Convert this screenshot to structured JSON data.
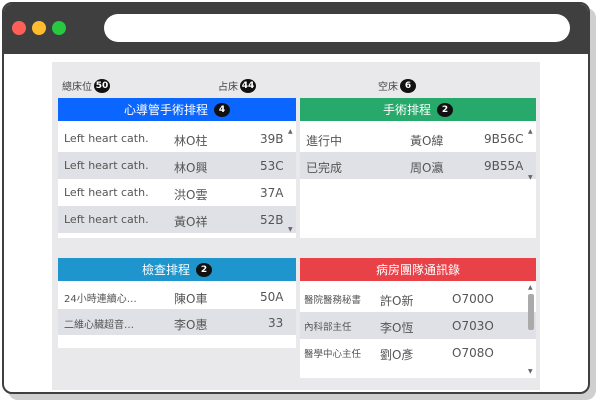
{
  "colors": {
    "blue": "#0a66ff",
    "green": "#27a96b",
    "teal": "#1e95cc",
    "red": "#e84148"
  },
  "stats": [
    {
      "label": "總床位",
      "value": "50"
    },
    {
      "label": "占床",
      "value": "44"
    },
    {
      "label": "空床",
      "value": "6"
    }
  ],
  "cath": {
    "title": "心導管手術排程",
    "count": "4",
    "rows": [
      {
        "proc": "Left heart cath.",
        "name": "林O柱",
        "bed": "39B"
      },
      {
        "proc": "Left heart cath.",
        "name": "林O興",
        "bed": "53C"
      },
      {
        "proc": "Left heart cath.",
        "name": "洪O雲",
        "bed": "37A"
      },
      {
        "proc": "Left heart cath.",
        "name": "黃O祥",
        "bed": "52B"
      }
    ]
  },
  "surgery": {
    "title": "手術排程",
    "count": "2",
    "rows": [
      {
        "status": "進行中",
        "name": "黃O緯",
        "bed": "9B56C"
      },
      {
        "status": "已完成",
        "name": "周O瀛",
        "bed": "9B55A"
      }
    ]
  },
  "exam": {
    "title": "檢查排程",
    "count": "2",
    "rows": [
      {
        "proc": "24小時連續心…",
        "name": "陳O車",
        "bed": "50A"
      },
      {
        "proc": "二維心臟超音…",
        "name": "李O惠",
        "bed": "33"
      }
    ]
  },
  "contacts": {
    "title": "病房團隊通訊錄",
    "rows": [
      {
        "role": "醫院醫務秘書",
        "name": "許O新",
        "ext": "O700O"
      },
      {
        "role": "內科部主任",
        "name": "李O恆",
        "ext": "O703O"
      },
      {
        "role": "醫學中心主任",
        "name": "劉O彥",
        "ext": "O708O"
      }
    ]
  }
}
